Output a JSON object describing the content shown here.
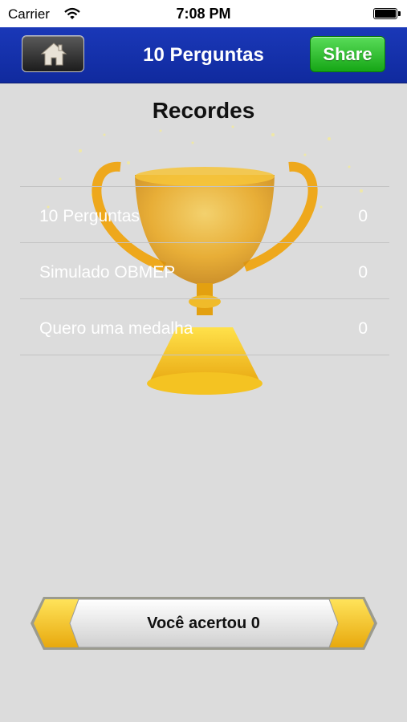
{
  "status_bar": {
    "carrier": "Carrier",
    "time": "7:08 PM"
  },
  "nav": {
    "title": "10 Perguntas",
    "share_label": "Share",
    "home_icon": "home-icon"
  },
  "page": {
    "title": "Recordes"
  },
  "records": [
    {
      "name": "10 Perguntas",
      "value": "0"
    },
    {
      "name": "Simulado OBMEP",
      "value": "0"
    },
    {
      "name": "Quero uma medalha",
      "value": "0"
    }
  ],
  "result": {
    "label": "Você acertou 0"
  },
  "colors": {
    "nav_blue": "#1a38b8",
    "share_green": "#22b422",
    "trophy_gold": "#f2b21c",
    "background": "#dcdcdc"
  }
}
